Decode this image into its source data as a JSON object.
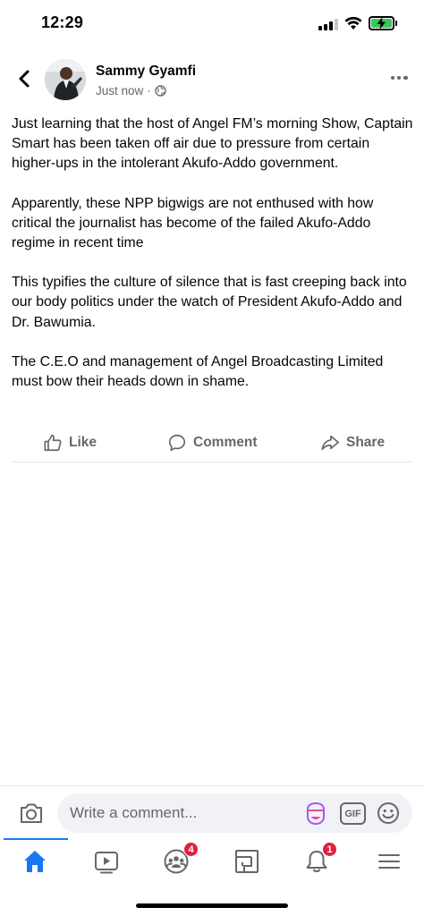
{
  "status_bar": {
    "time": "12:29"
  },
  "post": {
    "author": "Sammy Gyamfi",
    "timestamp": "Just now",
    "separator": "·",
    "privacy_icon": "globe-icon",
    "paragraphs": [
      "Just learning that the host of Angel FM’s morning Show, Captain Smart has been taken off air due to pressure from certain higher-ups in the intolerant Akufo-Addo government.",
      "Apparently, these NPP bigwigs are not enthused with how critical the journalist has become of the failed Akufo-Addo regime in recent time",
      "This typifies the culture of silence that is fast creeping back into our body politics under the watch of President Akufo-Addo and Dr. Bawumia.",
      "The C.E.O and management of Angel Broadcasting Limited must bow their heads down in shame."
    ]
  },
  "actions": {
    "like": "Like",
    "comment": "Comment",
    "share": "Share"
  },
  "comment_bar": {
    "placeholder": "Write a comment...",
    "gif_label": "GIF"
  },
  "tabs": {
    "groups_badge": "4",
    "notifications_badge": "1"
  },
  "colors": {
    "accent": "#1877f2",
    "badge": "#e41e3f",
    "secondary_text": "#65676b"
  }
}
